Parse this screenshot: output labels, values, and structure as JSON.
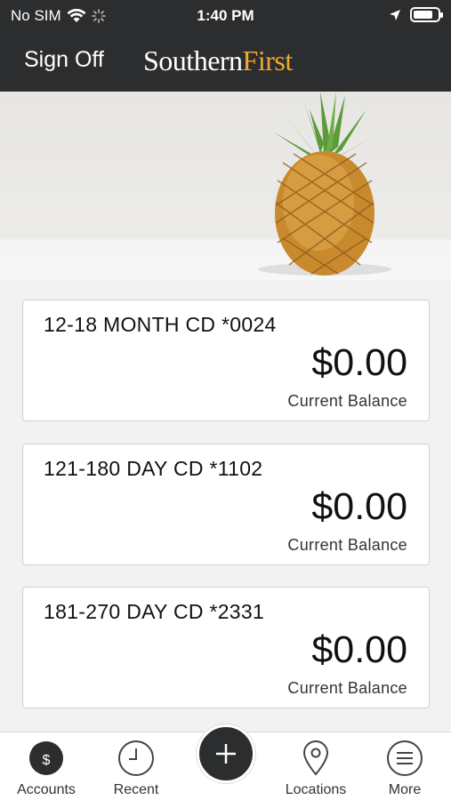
{
  "status_bar": {
    "carrier": "No SIM",
    "time": "1:40 PM",
    "icons": [
      "wifi-icon",
      "loading-spinner-icon",
      "location-arrow-icon",
      "battery-icon"
    ],
    "battery_level": 0.7
  },
  "header": {
    "sign_off_label": "Sign Off",
    "logo_part1": "Southern",
    "logo_part2": "First",
    "brand_color": "#f0a830",
    "header_bg": "#2b2d2f"
  },
  "accounts": [
    {
      "name": "12-18 MONTH CD *0024",
      "balance": "$0.00",
      "balance_label": "Current Balance"
    },
    {
      "name": "121-180 DAY CD *1102",
      "balance": "$0.00",
      "balance_label": "Current Balance"
    },
    {
      "name": "181-270 DAY CD *2331",
      "balance": "$0.00",
      "balance_label": "Current Balance"
    }
  ],
  "tabbar": {
    "accounts": {
      "label": "Accounts",
      "icon": "dollar-icon"
    },
    "recent": {
      "label": "Recent",
      "icon": "clock-icon"
    },
    "add": {
      "icon": "plus-icon"
    },
    "locations": {
      "label": "Locations",
      "icon": "map-pin-icon"
    },
    "more": {
      "label": "More",
      "icon": "menu-icon"
    }
  }
}
